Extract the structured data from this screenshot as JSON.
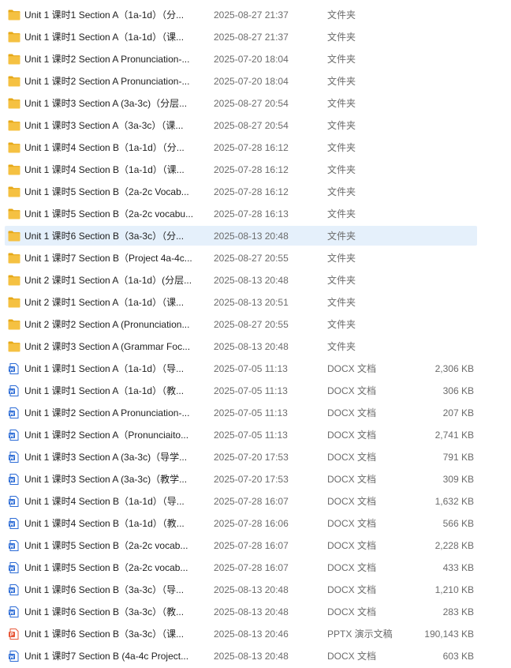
{
  "files": [
    {
      "name": "Unit 1 课时1 Section A（1a-1d）（分...",
      "date": "2025-08-27 21:37",
      "type": "文件夹",
      "size": "",
      "icon": "folder-icon"
    },
    {
      "name": "Unit 1 课时1 Section A（1a-1d）（课...",
      "date": "2025-08-27 21:37",
      "type": "文件夹",
      "size": "",
      "icon": "folder-icon"
    },
    {
      "name": "Unit 1 课时2 Section A Pronunciation-...",
      "date": "2025-07-20 18:04",
      "type": "文件夹",
      "size": "",
      "icon": "folder-icon"
    },
    {
      "name": "Unit 1 课时2 Section A Pronunciation-...",
      "date": "2025-07-20 18:04",
      "type": "文件夹",
      "size": "",
      "icon": "folder-icon"
    },
    {
      "name": "Unit 1 课时3 Section A (3a-3c)（分层...",
      "date": "2025-08-27 20:54",
      "type": "文件夹",
      "size": "",
      "icon": "folder-icon"
    },
    {
      "name": "Unit 1 课时3 Section A（3a-3c）（课...",
      "date": "2025-08-27 20:54",
      "type": "文件夹",
      "size": "",
      "icon": "folder-icon"
    },
    {
      "name": "Unit 1 课时4 Section B（1a-1d）（分...",
      "date": "2025-07-28 16:12",
      "type": "文件夹",
      "size": "",
      "icon": "folder-icon"
    },
    {
      "name": "Unit 1 课时4 Section B（1a-1d）（课...",
      "date": "2025-07-28 16:12",
      "type": "文件夹",
      "size": "",
      "icon": "folder-icon"
    },
    {
      "name": "Unit 1 课时5 Section B（2a-2c Vocab...",
      "date": "2025-07-28 16:12",
      "type": "文件夹",
      "size": "",
      "icon": "folder-icon"
    },
    {
      "name": "Unit 1 课时5 Section B（2a-2c vocabu...",
      "date": "2025-07-28 16:13",
      "type": "文件夹",
      "size": "",
      "icon": "folder-icon"
    },
    {
      "name": "Unit 1 课时6 Section B（3a-3c）（分...",
      "date": "2025-08-13 20:48",
      "type": "文件夹",
      "size": "",
      "icon": "folder-icon",
      "selected": true
    },
    {
      "name": "Unit 1 课时7 Section B（Project 4a-4c...",
      "date": "2025-08-27 20:55",
      "type": "文件夹",
      "size": "",
      "icon": "folder-icon"
    },
    {
      "name": "Unit 2 课时1 Section A（1a-1d）(分层...",
      "date": "2025-08-13 20:48",
      "type": "文件夹",
      "size": "",
      "icon": "folder-icon"
    },
    {
      "name": "Unit 2 课时1 Section A（1a-1d）（课...",
      "date": "2025-08-13 20:51",
      "type": "文件夹",
      "size": "",
      "icon": "folder-icon"
    },
    {
      "name": "Unit 2 课时2 Section A (Pronunciation...",
      "date": "2025-08-27 20:55",
      "type": "文件夹",
      "size": "",
      "icon": "folder-icon"
    },
    {
      "name": "Unit 2 课时3 Section A (Grammar Foc...",
      "date": "2025-08-13 20:48",
      "type": "文件夹",
      "size": "",
      "icon": "folder-icon"
    },
    {
      "name": "Unit 1 课时1 Section A（1a-1d）（导...",
      "date": "2025-07-05 11:13",
      "type": "DOCX 文档",
      "size": "2,306 KB",
      "icon": "docx-icon"
    },
    {
      "name": "Unit 1 课时1 Section A（1a-1d）（教...",
      "date": "2025-07-05 11:13",
      "type": "DOCX 文档",
      "size": "306 KB",
      "icon": "docx-icon"
    },
    {
      "name": "Unit 1 课时2 Section A Pronunciation-...",
      "date": "2025-07-05 11:13",
      "type": "DOCX 文档",
      "size": "207 KB",
      "icon": "docx-icon"
    },
    {
      "name": "Unit 1 课时2 Section A（Pronunciaito...",
      "date": "2025-07-05 11:13",
      "type": "DOCX 文档",
      "size": "2,741 KB",
      "icon": "docx-icon"
    },
    {
      "name": "Unit 1 课时3 Section A (3a-3c)（导学...",
      "date": "2025-07-20 17:53",
      "type": "DOCX 文档",
      "size": "791 KB",
      "icon": "docx-icon"
    },
    {
      "name": "Unit 1 课时3 Section A (3a-3c)（教学...",
      "date": "2025-07-20 17:53",
      "type": "DOCX 文档",
      "size": "309 KB",
      "icon": "docx-icon"
    },
    {
      "name": "Unit 1 课时4 Section B（1a-1d）（导...",
      "date": "2025-07-28 16:07",
      "type": "DOCX 文档",
      "size": "1,632 KB",
      "icon": "docx-icon"
    },
    {
      "name": "Unit 1 课时4 Section B（1a-1d）（教...",
      "date": "2025-07-28 16:06",
      "type": "DOCX 文档",
      "size": "566 KB",
      "icon": "docx-icon"
    },
    {
      "name": "Unit 1 课时5 Section B（2a-2c vocab...",
      "date": "2025-07-28 16:07",
      "type": "DOCX 文档",
      "size": "2,228 KB",
      "icon": "docx-icon"
    },
    {
      "name": "Unit 1 课时5 Section B（2a-2c vocab...",
      "date": "2025-07-28 16:07",
      "type": "DOCX 文档",
      "size": "433 KB",
      "icon": "docx-icon"
    },
    {
      "name": "Unit 1 课时6 Section B（3a-3c）（导...",
      "date": "2025-08-13 20:48",
      "type": "DOCX 文档",
      "size": "1,210 KB",
      "icon": "docx-icon"
    },
    {
      "name": "Unit 1 课时6 Section B（3a-3c）（教...",
      "date": "2025-08-13 20:48",
      "type": "DOCX 文档",
      "size": "283 KB",
      "icon": "docx-icon"
    },
    {
      "name": "Unit 1 课时6 Section B（3a-3c）（课...",
      "date": "2025-08-13 20:46",
      "type": "PPTX 演示文稿",
      "size": "190,143 KB",
      "icon": "pptx-icon"
    },
    {
      "name": "Unit 1 课时7 Section B (4a-4c Project...",
      "date": "2025-08-13 20:48",
      "type": "DOCX 文档",
      "size": "603 KB",
      "icon": "docx-icon"
    }
  ],
  "colors": {
    "folder": "#f5c142",
    "folder_dark": "#e6a817",
    "docx": "#2b6bd6",
    "pptx": "#e8593a",
    "selected_bg": "#e5f0fb"
  }
}
